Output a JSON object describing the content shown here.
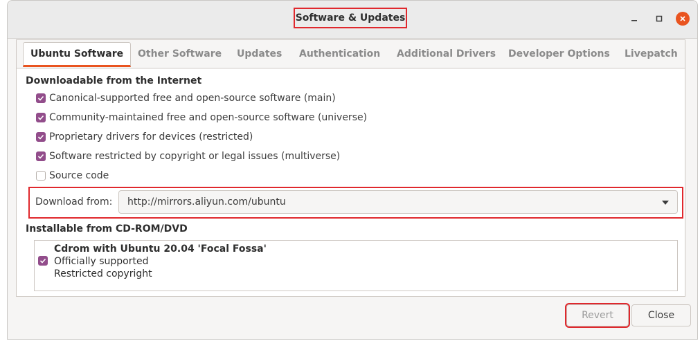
{
  "window": {
    "title": "Software & Updates"
  },
  "tabs": [
    {
      "label": "Ubuntu Software",
      "active": true
    },
    {
      "label": "Other Software",
      "active": false
    },
    {
      "label": "Updates",
      "active": false
    },
    {
      "label": "Authentication",
      "active": false
    },
    {
      "label": "Additional Drivers",
      "active": false
    },
    {
      "label": "Developer Options",
      "active": false
    },
    {
      "label": "Livepatch",
      "active": false
    }
  ],
  "internet": {
    "heading": "Downloadable from the Internet",
    "options": [
      {
        "label": "Canonical-supported free and open-source software (main)",
        "checked": true
      },
      {
        "label": "Community-maintained free and open-source software (universe)",
        "checked": true
      },
      {
        "label": "Proprietary drivers for devices (restricted)",
        "checked": true
      },
      {
        "label": "Software restricted by copyright or legal issues (multiverse)",
        "checked": true
      },
      {
        "label": "Source code",
        "checked": false
      }
    ],
    "download_from_label": "Download from:",
    "download_from_value": "http://mirrors.aliyun.com/ubuntu"
  },
  "cdrom": {
    "heading": "Installable from CD-ROM/DVD",
    "entry_title": "Cdrom with Ubuntu 20.04 'Focal Fossa'",
    "entry_line2": "Officially supported",
    "entry_line3": "Restricted copyright",
    "checked": true
  },
  "buttons": {
    "revert": "Revert",
    "close": "Close"
  },
  "colors": {
    "accent": "#e95420",
    "checkbox": "#924d8b",
    "highlight": "#e0282d"
  }
}
